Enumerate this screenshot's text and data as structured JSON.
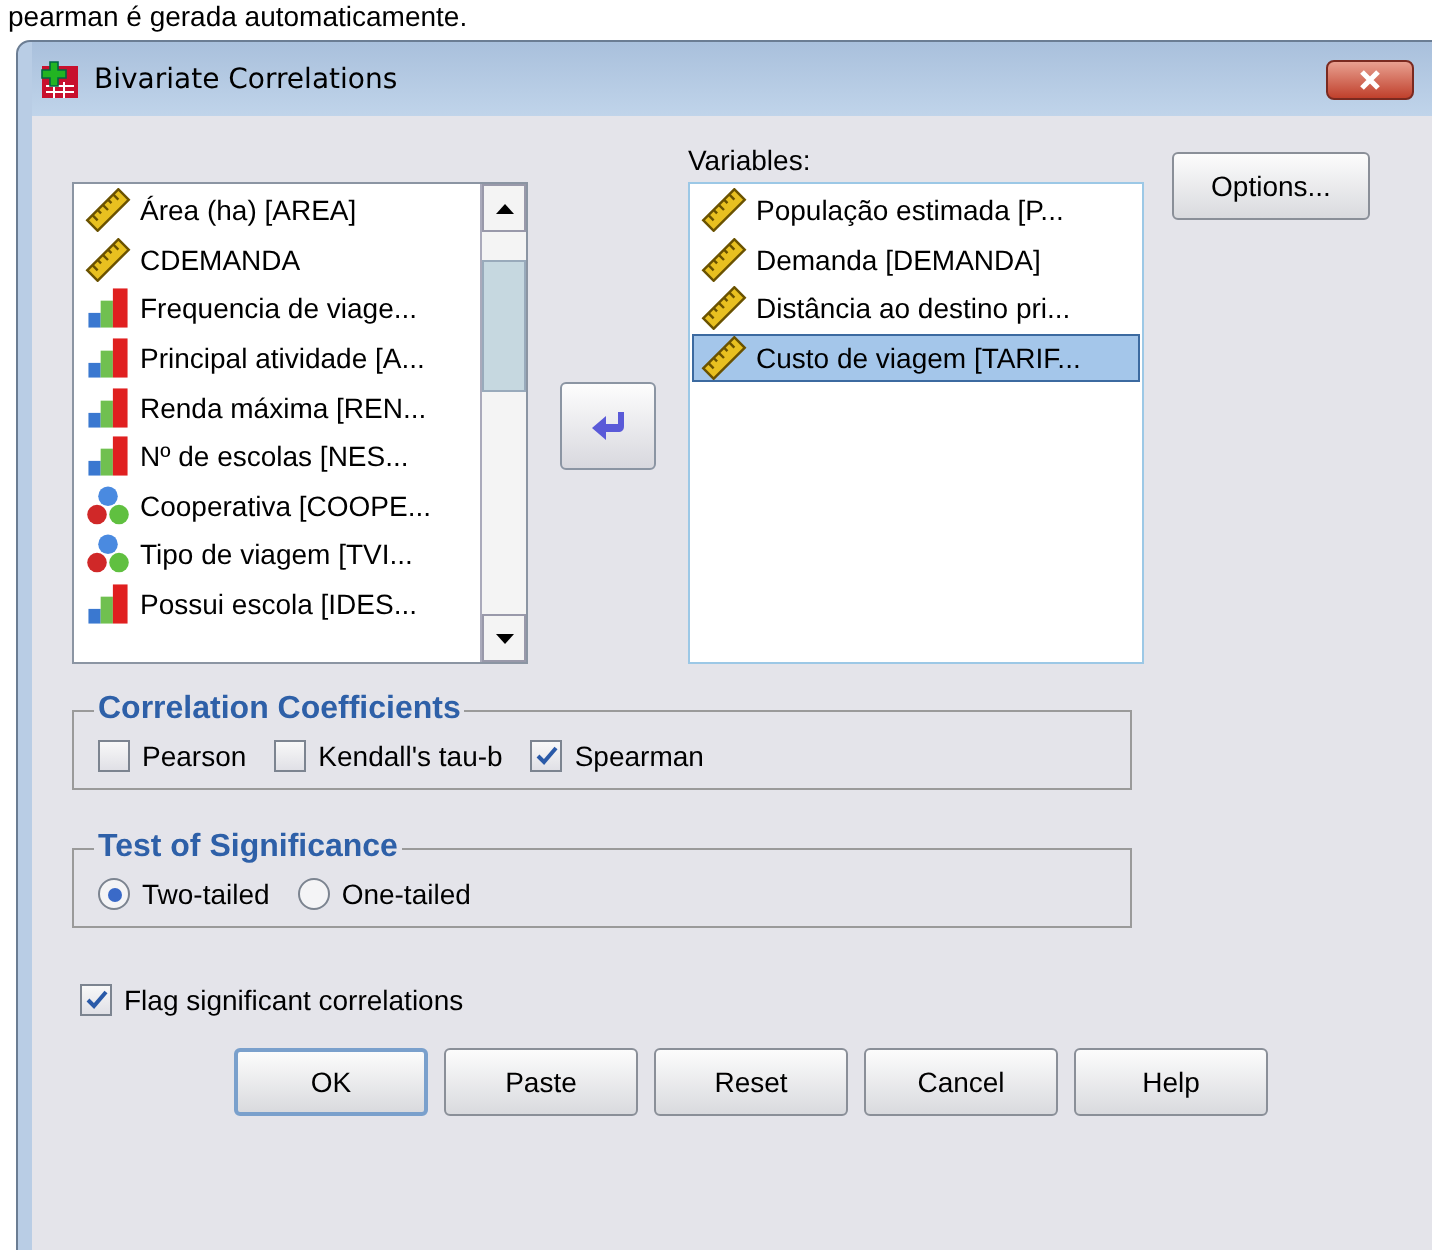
{
  "page_text": "pearman é gerada automaticamente.",
  "window": {
    "title": "Bivariate Correlations"
  },
  "source_list": [
    {
      "label": "Área (ha) [AREA]",
      "kind": "scale",
      "selected": false
    },
    {
      "label": "CDEMANDA",
      "kind": "scale",
      "selected": false
    },
    {
      "label": "Frequencia de viage...",
      "kind": "ordinal",
      "selected": false
    },
    {
      "label": "Principal atividade [A...",
      "kind": "ordinal",
      "selected": false
    },
    {
      "label": "Renda máxima [REN...",
      "kind": "ordinal",
      "selected": false
    },
    {
      "label": "Nº de escolas [NES...",
      "kind": "ordinal",
      "selected": false
    },
    {
      "label": "Cooperativa [COOPE...",
      "kind": "nominal",
      "selected": false
    },
    {
      "label": "Tipo de viagem [TVI...",
      "kind": "nominal",
      "selected": false
    },
    {
      "label": "Possui escola [IDES...",
      "kind": "ordinal",
      "selected": false
    }
  ],
  "variables": {
    "label": "Variables:",
    "items": [
      {
        "label": "População estimada [P...",
        "kind": "scale",
        "selected": false
      },
      {
        "label": "Demanda [DEMANDA]",
        "kind": "scale",
        "selected": false
      },
      {
        "label": "Distância ao destino pri...",
        "kind": "scale",
        "selected": false
      },
      {
        "label": "Custo de viagem [TARIF...",
        "kind": "scale",
        "selected": true
      }
    ]
  },
  "options_button": "Options...",
  "correlation_coefficients": {
    "title": "Correlation Coefficients",
    "options": [
      {
        "label": "Pearson",
        "checked": false
      },
      {
        "label": "Kendall's tau-b",
        "checked": false
      },
      {
        "label": "Spearman",
        "checked": true
      }
    ]
  },
  "test_of_significance": {
    "title": "Test of Significance",
    "options": [
      {
        "label": "Two-tailed",
        "selected": true
      },
      {
        "label": "One-tailed",
        "selected": false
      }
    ]
  },
  "flag_significant": {
    "label": "Flag significant correlations",
    "checked": true
  },
  "buttons": [
    "OK",
    "Paste",
    "Reset",
    "Cancel",
    "Help"
  ]
}
